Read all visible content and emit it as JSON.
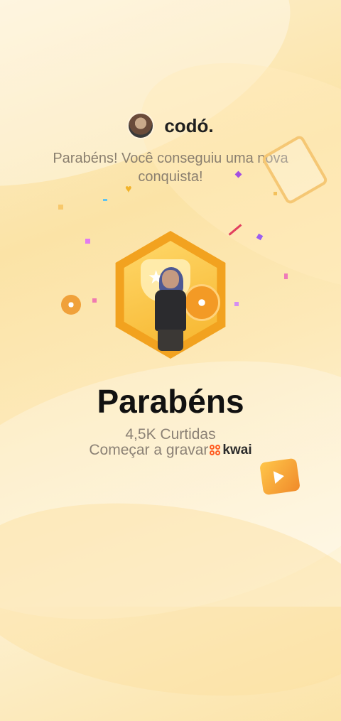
{
  "user": {
    "name": "codó."
  },
  "message": "Parabéns! Você conseguiu uma nova conquista!",
  "title": "Parabéns",
  "likes": "4,5K Curtidas",
  "record": {
    "label": "Começar a gravar",
    "brand": "kwai"
  },
  "colors": {
    "accent": "#f2a21f",
    "brand": "#ff5a1f",
    "background": "#fbe3a6"
  }
}
